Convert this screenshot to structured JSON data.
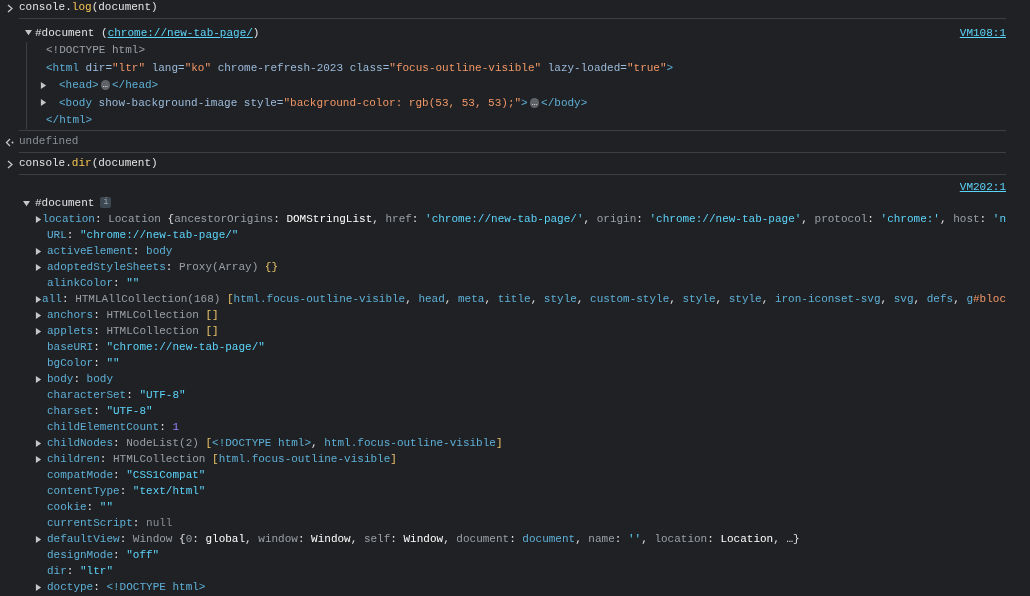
{
  "messages": [
    {
      "kind": "command",
      "segments": [
        {
          "text": "console.",
          "kind": "plain"
        },
        {
          "text": "log",
          "kind": "fn"
        },
        {
          "text": "(document)",
          "kind": "plain"
        }
      ]
    },
    {
      "kind": "log",
      "source": "VM108:1",
      "tree": {
        "kind": "elements",
        "expanded": true,
        "segments": [
          {
            "text": "#document (",
            "kind": "plain"
          },
          {
            "text": "chrome://new-tab-page/",
            "kind": "link"
          },
          {
            "text": ")",
            "kind": "plain"
          }
        ],
        "children": [
          {
            "segments": [
              {
                "text": "<!DOCTYPE html>",
                "kind": "doctype"
              }
            ]
          },
          {
            "segments": [
              {
                "text": "<html ",
                "kind": "tag"
              },
              {
                "text": "dir=",
                "kind": "attr"
              },
              {
                "text": "\"ltr\"",
                "kind": "attrval"
              },
              {
                "text": " lang=",
                "kind": "attr"
              },
              {
                "text": "\"ko\"",
                "kind": "attrval"
              },
              {
                "text": " chrome-refresh-2023 class=",
                "kind": "attr"
              },
              {
                "text": "\"focus-outline-visible\"",
                "kind": "attrval"
              },
              {
                "text": " lazy-loaded=",
                "kind": "attr"
              },
              {
                "text": "\"true\"",
                "kind": "attrval"
              },
              {
                "text": ">",
                "kind": "tag"
              }
            ]
          },
          {
            "expanded": false,
            "segments": [
              {
                "text": "<head>",
                "kind": "tag"
              },
              {
                "text": "…",
                "kind": "more"
              },
              {
                "text": "</head>",
                "kind": "tag"
              }
            ]
          },
          {
            "expanded": false,
            "segments": [
              {
                "text": "<body ",
                "kind": "tag"
              },
              {
                "text": "show-background-image style=",
                "kind": "attr"
              },
              {
                "text": "\"background-color: rgb(53, 53, 53);\"",
                "kind": "attrval"
              },
              {
                "text": ">",
                "kind": "tag"
              },
              {
                "text": "…",
                "kind": "more"
              },
              {
                "text": "</body>",
                "kind": "tag"
              }
            ]
          },
          {
            "segments": [
              {
                "text": "</html>",
                "kind": "tag"
              }
            ]
          }
        ]
      }
    },
    {
      "kind": "result",
      "segments": [
        {
          "text": "undefined",
          "kind": "null"
        }
      ]
    },
    {
      "kind": "command",
      "segments": [
        {
          "text": "console.",
          "kind": "plain"
        },
        {
          "text": "dir",
          "kind": "fn"
        },
        {
          "text": "(document)",
          "kind": "plain"
        }
      ]
    },
    {
      "kind": "dir",
      "source": "VM202:1",
      "tree": {
        "kind": "object",
        "expanded": true,
        "segments": [
          {
            "text": "#document",
            "kind": "plain"
          },
          {
            "text": "i",
            "kind": "info"
          }
        ],
        "children": [
          {
            "expanded": false,
            "segments": [
              {
                "text": "location",
                "kind": "key"
              },
              {
                "text": ": ",
                "kind": "plain"
              },
              {
                "text": "Location ",
                "kind": "type"
              },
              {
                "text": "{",
                "kind": "plain"
              },
              {
                "text": "ancestorOrigins",
                "kind": "pkey"
              },
              {
                "text": ": ",
                "kind": "plain"
              },
              {
                "text": "DOMStringList",
                "kind": "ident"
              },
              {
                "text": ", ",
                "kind": "plain"
              },
              {
                "text": "href",
                "kind": "pkey"
              },
              {
                "text": ": ",
                "kind": "plain"
              },
              {
                "text": "'chrome://new-tab-page/'",
                "kind": "string"
              },
              {
                "text": ", ",
                "kind": "plain"
              },
              {
                "text": "origin",
                "kind": "pkey"
              },
              {
                "text": ": ",
                "kind": "plain"
              },
              {
                "text": "'chrome://new-tab-page'",
                "kind": "string"
              },
              {
                "text": ", ",
                "kind": "plain"
              },
              {
                "text": "protocol",
                "kind": "pkey"
              },
              {
                "text": ": ",
                "kind": "plain"
              },
              {
                "text": "'chrome:'",
                "kind": "string"
              },
              {
                "text": ", ",
                "kind": "plain"
              },
              {
                "text": "host",
                "kind": "pkey"
              },
              {
                "text": ": ",
                "kind": "plain"
              },
              {
                "text": "'n",
                "kind": "string"
              }
            ]
          },
          {
            "segments": [
              {
                "text": "URL",
                "kind": "key"
              },
              {
                "text": ": ",
                "kind": "plain"
              },
              {
                "text": "\"chrome://new-tab-page/\"",
                "kind": "string"
              }
            ]
          },
          {
            "expanded": false,
            "segments": [
              {
                "text": "activeElement",
                "kind": "key"
              },
              {
                "text": ": ",
                "kind": "plain"
              },
              {
                "text": "body",
                "kind": "node"
              }
            ]
          },
          {
            "expanded": false,
            "segments": [
              {
                "text": "adoptedStyleSheets",
                "kind": "key"
              },
              {
                "text": ": ",
                "kind": "plain"
              },
              {
                "text": "Proxy(Array) ",
                "kind": "type"
              },
              {
                "text": "{}",
                "kind": "bracket"
              }
            ]
          },
          {
            "segments": [
              {
                "text": "alinkColor",
                "kind": "key"
              },
              {
                "text": ": ",
                "kind": "plain"
              },
              {
                "text": "\"\"",
                "kind": "string"
              }
            ]
          },
          {
            "expanded": false,
            "segments": [
              {
                "text": "all",
                "kind": "key"
              },
              {
                "text": ": ",
                "kind": "plain"
              },
              {
                "text": "HTMLAllCollection(168) ",
                "kind": "type"
              },
              {
                "text": "[",
                "kind": "bracket"
              },
              {
                "text": "html.focus-outline-visible",
                "kind": "node"
              },
              {
                "text": ", ",
                "kind": "plain"
              },
              {
                "text": "head",
                "kind": "node"
              },
              {
                "text": ", ",
                "kind": "plain"
              },
              {
                "text": "meta",
                "kind": "node"
              },
              {
                "text": ", ",
                "kind": "plain"
              },
              {
                "text": "title",
                "kind": "node"
              },
              {
                "text": ", ",
                "kind": "plain"
              },
              {
                "text": "style",
                "kind": "node"
              },
              {
                "text": ", ",
                "kind": "plain"
              },
              {
                "text": "custom-style",
                "kind": "node"
              },
              {
                "text": ", ",
                "kind": "plain"
              },
              {
                "text": "style",
                "kind": "node"
              },
              {
                "text": ", ",
                "kind": "plain"
              },
              {
                "text": "style",
                "kind": "node"
              },
              {
                "text": ", ",
                "kind": "plain"
              },
              {
                "text": "iron-iconset-svg",
                "kind": "node"
              },
              {
                "text": ", ",
                "kind": "plain"
              },
              {
                "text": "svg",
                "kind": "node"
              },
              {
                "text": ", ",
                "kind": "plain"
              },
              {
                "text": "defs",
                "kind": "node"
              },
              {
                "text": ", ",
                "kind": "plain"
              },
              {
                "text": "g",
                "kind": "node"
              },
              {
                "text": "#bloc",
                "kind": "id"
              }
            ]
          },
          {
            "expanded": false,
            "segments": [
              {
                "text": "anchors",
                "kind": "key"
              },
              {
                "text": ": ",
                "kind": "plain"
              },
              {
                "text": "HTMLCollection ",
                "kind": "type"
              },
              {
                "text": "[]",
                "kind": "bracket"
              }
            ]
          },
          {
            "expanded": false,
            "segments": [
              {
                "text": "applets",
                "kind": "key"
              },
              {
                "text": ": ",
                "kind": "plain"
              },
              {
                "text": "HTMLCollection ",
                "kind": "type"
              },
              {
                "text": "[]",
                "kind": "bracket"
              }
            ]
          },
          {
            "segments": [
              {
                "text": "baseURI",
                "kind": "key"
              },
              {
                "text": ": ",
                "kind": "plain"
              },
              {
                "text": "\"chrome://new-tab-page/\"",
                "kind": "string"
              }
            ]
          },
          {
            "segments": [
              {
                "text": "bgColor",
                "kind": "key"
              },
              {
                "text": ": ",
                "kind": "plain"
              },
              {
                "text": "\"\"",
                "kind": "string"
              }
            ]
          },
          {
            "expanded": false,
            "segments": [
              {
                "text": "body",
                "kind": "key"
              },
              {
                "text": ": ",
                "kind": "plain"
              },
              {
                "text": "body",
                "kind": "node"
              }
            ]
          },
          {
            "segments": [
              {
                "text": "characterSet",
                "kind": "key"
              },
              {
                "text": ": ",
                "kind": "plain"
              },
              {
                "text": "\"UTF-8\"",
                "kind": "string"
              }
            ]
          },
          {
            "segments": [
              {
                "text": "charset",
                "kind": "key"
              },
              {
                "text": ": ",
                "kind": "plain"
              },
              {
                "text": "\"UTF-8\"",
                "kind": "string"
              }
            ]
          },
          {
            "segments": [
              {
                "text": "childElementCount",
                "kind": "key"
              },
              {
                "text": ": ",
                "kind": "plain"
              },
              {
                "text": "1",
                "kind": "number"
              }
            ]
          },
          {
            "expanded": false,
            "segments": [
              {
                "text": "childNodes",
                "kind": "key"
              },
              {
                "text": ": ",
                "kind": "plain"
              },
              {
                "text": "NodeList(2) ",
                "kind": "type"
              },
              {
                "text": "[",
                "kind": "bracket"
              },
              {
                "text": "<!DOCTYPE html>",
                "kind": "node"
              },
              {
                "text": ", ",
                "kind": "plain"
              },
              {
                "text": "html.focus-outline-visible",
                "kind": "node"
              },
              {
                "text": "]",
                "kind": "bracket"
              }
            ]
          },
          {
            "expanded": false,
            "segments": [
              {
                "text": "children",
                "kind": "key"
              },
              {
                "text": ": ",
                "kind": "plain"
              },
              {
                "text": "HTMLCollection ",
                "kind": "type"
              },
              {
                "text": "[",
                "kind": "bracket"
              },
              {
                "text": "html.focus-outline-visible",
                "kind": "node"
              },
              {
                "text": "]",
                "kind": "bracket"
              }
            ]
          },
          {
            "segments": [
              {
                "text": "compatMode",
                "kind": "key"
              },
              {
                "text": ": ",
                "kind": "plain"
              },
              {
                "text": "\"CSS1Compat\"",
                "kind": "string"
              }
            ]
          },
          {
            "segments": [
              {
                "text": "contentType",
                "kind": "key"
              },
              {
                "text": ": ",
                "kind": "plain"
              },
              {
                "text": "\"text/html\"",
                "kind": "string"
              }
            ]
          },
          {
            "segments": [
              {
                "text": "cookie",
                "kind": "key"
              },
              {
                "text": ": ",
                "kind": "plain"
              },
              {
                "text": "\"\"",
                "kind": "string"
              }
            ]
          },
          {
            "segments": [
              {
                "text": "currentScript",
                "kind": "key"
              },
              {
                "text": ": ",
                "kind": "plain"
              },
              {
                "text": "null",
                "kind": "null"
              }
            ]
          },
          {
            "expanded": false,
            "segments": [
              {
                "text": "defaultView",
                "kind": "key"
              },
              {
                "text": ": ",
                "kind": "plain"
              },
              {
                "text": "Window ",
                "kind": "type"
              },
              {
                "text": "{",
                "kind": "plain"
              },
              {
                "text": "0",
                "kind": "pkey"
              },
              {
                "text": ": ",
                "kind": "plain"
              },
              {
                "text": "global",
                "kind": "ident"
              },
              {
                "text": ", ",
                "kind": "plain"
              },
              {
                "text": "window",
                "kind": "pkey"
              },
              {
                "text": ": ",
                "kind": "plain"
              },
              {
                "text": "Window",
                "kind": "ident"
              },
              {
                "text": ", ",
                "kind": "plain"
              },
              {
                "text": "self",
                "kind": "pkey"
              },
              {
                "text": ": ",
                "kind": "plain"
              },
              {
                "text": "Window",
                "kind": "ident"
              },
              {
                "text": ", ",
                "kind": "plain"
              },
              {
                "text": "document",
                "kind": "pkey"
              },
              {
                "text": ": ",
                "kind": "plain"
              },
              {
                "text": "document",
                "kind": "node"
              },
              {
                "text": ", ",
                "kind": "plain"
              },
              {
                "text": "name",
                "kind": "pkey"
              },
              {
                "text": ": ",
                "kind": "plain"
              },
              {
                "text": "''",
                "kind": "string"
              },
              {
                "text": ", ",
                "kind": "plain"
              },
              {
                "text": "location",
                "kind": "pkey"
              },
              {
                "text": ": ",
                "kind": "plain"
              },
              {
                "text": "Location",
                "kind": "ident"
              },
              {
                "text": ", …}",
                "kind": "plain"
              }
            ]
          },
          {
            "segments": [
              {
                "text": "designMode",
                "kind": "key"
              },
              {
                "text": ": ",
                "kind": "plain"
              },
              {
                "text": "\"off\"",
                "kind": "string"
              }
            ]
          },
          {
            "segments": [
              {
                "text": "dir",
                "kind": "key"
              },
              {
                "text": ": ",
                "kind": "plain"
              },
              {
                "text": "\"ltr\"",
                "kind": "string"
              }
            ]
          },
          {
            "expanded": false,
            "segments": [
              {
                "text": "doctype",
                "kind": "key"
              },
              {
                "text": ": ",
                "kind": "plain"
              },
              {
                "text": "<!DOCTYPE html>",
                "kind": "node"
              }
            ]
          }
        ]
      }
    }
  ]
}
